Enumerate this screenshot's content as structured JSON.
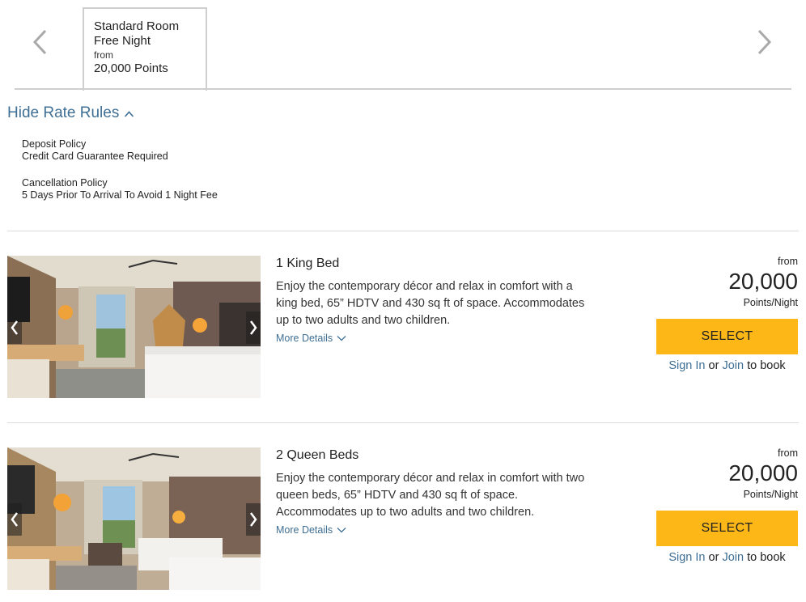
{
  "rate_tabs": {
    "prev_icon": "chevron-left-icon",
    "next_icon": "chevron-right-icon",
    "active": {
      "line1": "Standard Room",
      "line2": "Free Night",
      "from": "from",
      "points": "20,000 Points"
    }
  },
  "rules": {
    "toggle_label": "Hide Rate Rules",
    "toggle_icon": "chevron-up-icon",
    "deposit_title": "Deposit Policy",
    "deposit_value": "Credit Card Guarantee Required",
    "cancel_title": "Cancellation Policy",
    "cancel_value": "5 Days Prior To Arrival To Avoid 1 Night Fee"
  },
  "rooms": [
    {
      "title": "1 King Bed",
      "description": "Enjoy the contemporary décor and relax in comfort with a king bed, 65” HDTV and 430 sq ft of space. Accommodates up to two adults and two children.",
      "more_details": "More Details",
      "from": "from",
      "price": "20,000",
      "unit": "Points/Night",
      "select_label": "SELECT",
      "sign_in": "Sign In",
      "or": "or",
      "join": "Join",
      "to_book": "to book"
    },
    {
      "title": "2 Queen Beds",
      "description": "Enjoy the contemporary décor and relax in comfort with two queen beds, 65” HDTV and 430 sq ft of space. Accommodates up to two adults and two children.",
      "more_details": "More Details",
      "from": "from",
      "price": "20,000",
      "unit": "Points/Night",
      "select_label": "SELECT",
      "sign_in": "Sign In",
      "or": "or",
      "join": "Join",
      "to_book": "to book"
    }
  ],
  "colors": {
    "accent_blue": "#3f6f94",
    "select_yellow": "#fdb817",
    "divider": "#dcdcdc"
  }
}
